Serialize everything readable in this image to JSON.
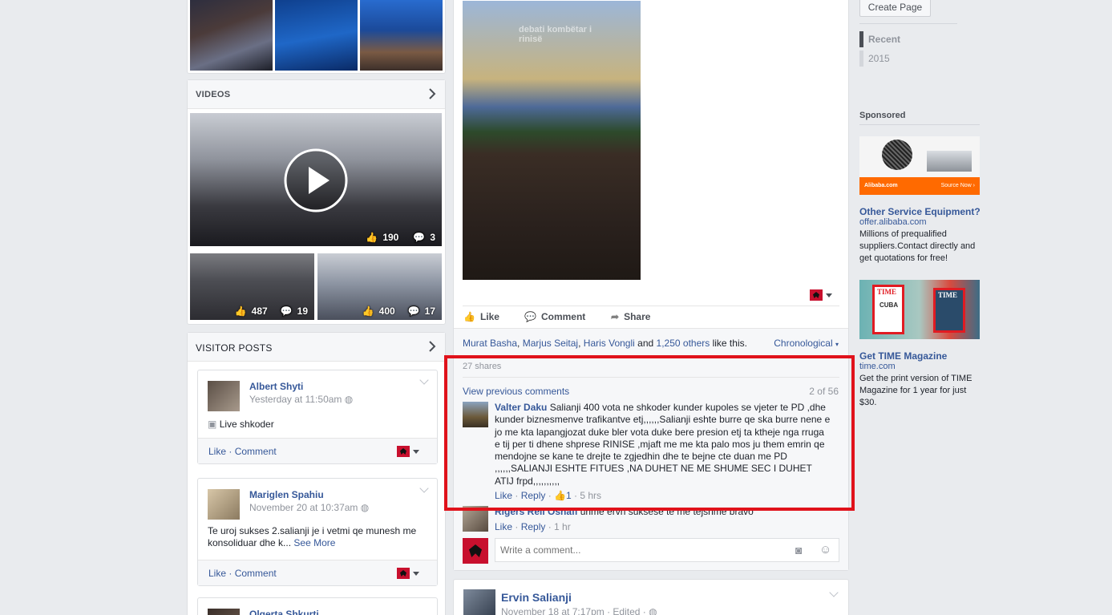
{
  "left": {
    "videos_title": "VIDEOS",
    "videos": [
      {
        "likes": "190",
        "comments": "3"
      },
      {
        "likes": "487",
        "comments": "19"
      },
      {
        "likes": "400",
        "comments": "17"
      }
    ],
    "visitor_posts_title": "VISITOR POSTS",
    "visitor_posts": [
      {
        "name": "Albert Shyti",
        "time": "Yesterday at 11:50am",
        "text": "Live shkoder"
      },
      {
        "name": "Mariglen Spahiu",
        "time": "November 20 at 10:37am",
        "text": "Te uroj sukses 2.salianji je i vetmi qe munesh me konsoliduar dhe k...",
        "see_more": "See More"
      },
      {
        "name": "Olgerta Shkurti"
      }
    ],
    "like_label": "Like",
    "comment_label": "Comment",
    "separator": " · "
  },
  "post": {
    "photo_text": "debati kombëtar i rinisë",
    "actions": {
      "like": "Like",
      "comment": "Comment",
      "share": "Share"
    },
    "likers": [
      "Murat Basha",
      "Marjus Seitaj",
      "Haris Vongli"
    ],
    "likers_and": "and",
    "likers_others": "1,250 others",
    "likers_suffix": "like this.",
    "comma": ",",
    "order": "Chronological",
    "shares": "27 shares",
    "view_previous": "View previous comments",
    "comment_count": "2 of 56",
    "comments": [
      {
        "name": "Valter Daku",
        "text": "Salianji 400 vota ne shkoder kunder kupoles se vjeter te PD ,dhe kunder biznesmenve trafikantve etj,,,,,,Salianji eshte burre qe ska burre nene e jo me kta lapangjozat duke bler vota duke bere presion etj ta ktheje nga rruga e tij per ti dhene shprese RINISE ,mjaft me me kta palo mos ju them emrin qe mendojne se kane te drejte te zgjedhin dhe te bejne cte duan me PD ,,,,,,SALIANJI ESHTE FITUES ,NA DUHET NE ME SHUME SEC I DUHET ATIJ frpd,,,,,,,,,,",
        "like": "Like",
        "reply": "Reply",
        "likes": "1",
        "time": "5 hrs"
      },
      {
        "name": "Rigers Reli Oshafi",
        "text": "urime ervn suksese te me tejshme bravo",
        "like": "Like",
        "reply": "Reply",
        "time": "1 hr"
      }
    ],
    "write_placeholder": "Write a comment..."
  },
  "next_post": {
    "name": "Ervin Salianji",
    "time": "November 18 at 7:17pm",
    "edited": "Edited"
  },
  "right": {
    "create_page": "Create Page",
    "years": [
      "Recent",
      "2015"
    ],
    "sponsored": "Sponsored",
    "ads": [
      {
        "brand_tag": "Alibaba.com",
        "source_now": "Source Now ›",
        "title": "Other Service Equipment?",
        "domain": "offer.alibaba.com",
        "body": "Millions of prequalified suppliers.Contact directly and get quotations for free!"
      },
      {
        "cover_word": "TIME",
        "cover_word2": "CUBA",
        "title": "Get TIME Magazine",
        "domain": "time.com",
        "body": "Get the print version of TIME Magazine for 1 year for just $30."
      }
    ]
  },
  "highlight_color": "#e0121b"
}
